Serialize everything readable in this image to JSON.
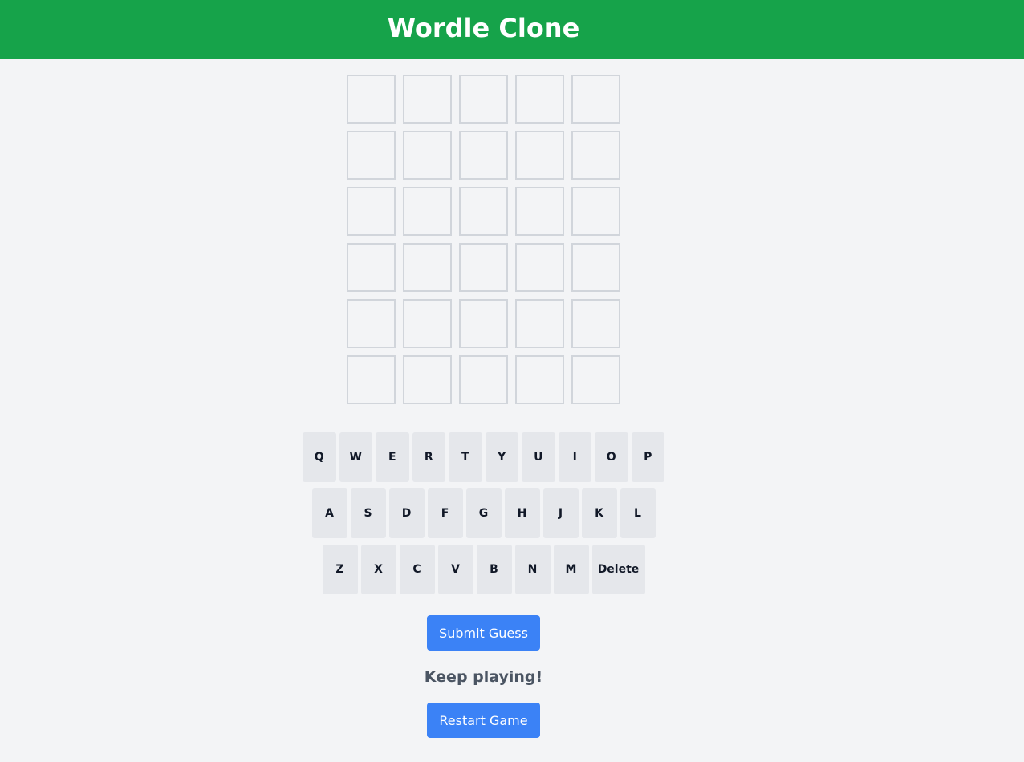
{
  "header": {
    "title": "Wordle Clone",
    "color": "#16a34a"
  },
  "board": {
    "rows": [
      [
        "",
        "",
        "",
        "",
        ""
      ],
      [
        "",
        "",
        "",
        "",
        ""
      ],
      [
        "",
        "",
        "",
        "",
        ""
      ],
      [
        "",
        "",
        "",
        "",
        ""
      ],
      [
        "",
        "",
        "",
        "",
        ""
      ],
      [
        "",
        "",
        "",
        "",
        ""
      ]
    ]
  },
  "keyboard": {
    "rows": [
      [
        "Q",
        "W",
        "E",
        "R",
        "T",
        "Y",
        "U",
        "I",
        "O",
        "P"
      ],
      [
        "A",
        "S",
        "D",
        "F",
        "G",
        "H",
        "J",
        "K",
        "L"
      ],
      [
        "Z",
        "X",
        "C",
        "V",
        "B",
        "N",
        "M",
        "Delete"
      ]
    ],
    "key_color": "#e5e7eb"
  },
  "actions": {
    "submit_label": "Submit Guess",
    "status_text": "Keep playing!",
    "restart_label": "Restart Game",
    "button_color": "#3b82f6"
  }
}
